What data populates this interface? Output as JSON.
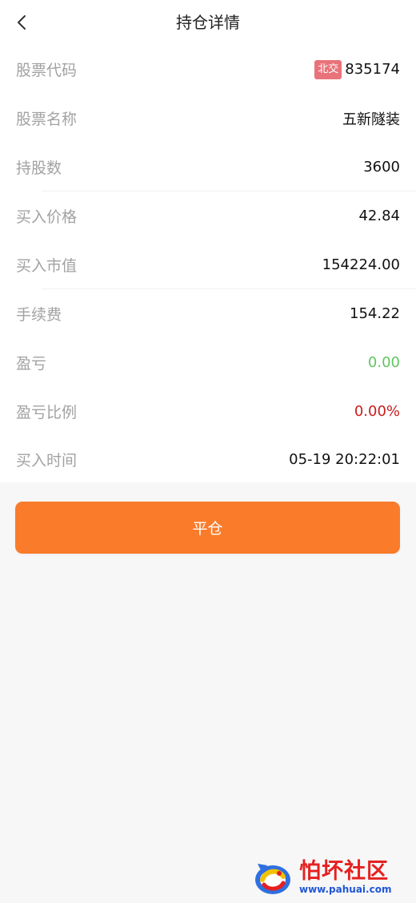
{
  "header": {
    "title": "持仓详情",
    "back_icon": "chevron-left-icon"
  },
  "details": {
    "stock_code": {
      "label": "股票代码",
      "exchange_badge": "北交",
      "value": "835174"
    },
    "stock_name": {
      "label": "股票名称",
      "value": "五新隧装"
    },
    "shares": {
      "label": "持股数",
      "value": "3600"
    },
    "buy_price": {
      "label": "买入价格",
      "value": "42.84"
    },
    "market_value": {
      "label": "买入市值",
      "value": "154224.00"
    },
    "fee": {
      "label": "手续费",
      "value": "154.22"
    },
    "pnl": {
      "label": "盈亏",
      "value": "0.00"
    },
    "pnl_ratio": {
      "label": "盈亏比例",
      "value": "0.00%"
    },
    "buy_time": {
      "label": "买入时间",
      "value": "05-19 20:22:01"
    }
  },
  "actions": {
    "close_position_label": "平仓"
  },
  "watermark": {
    "title": "怕坏社区",
    "url": "www.pahuai.com"
  },
  "colors": {
    "accent": "#fa7c2b",
    "badge": "#e8737b",
    "gain_green": "#60c560",
    "loss_red": "#c81d1d",
    "label_gray": "#a2a2a2",
    "background": "#f7f7f7"
  }
}
